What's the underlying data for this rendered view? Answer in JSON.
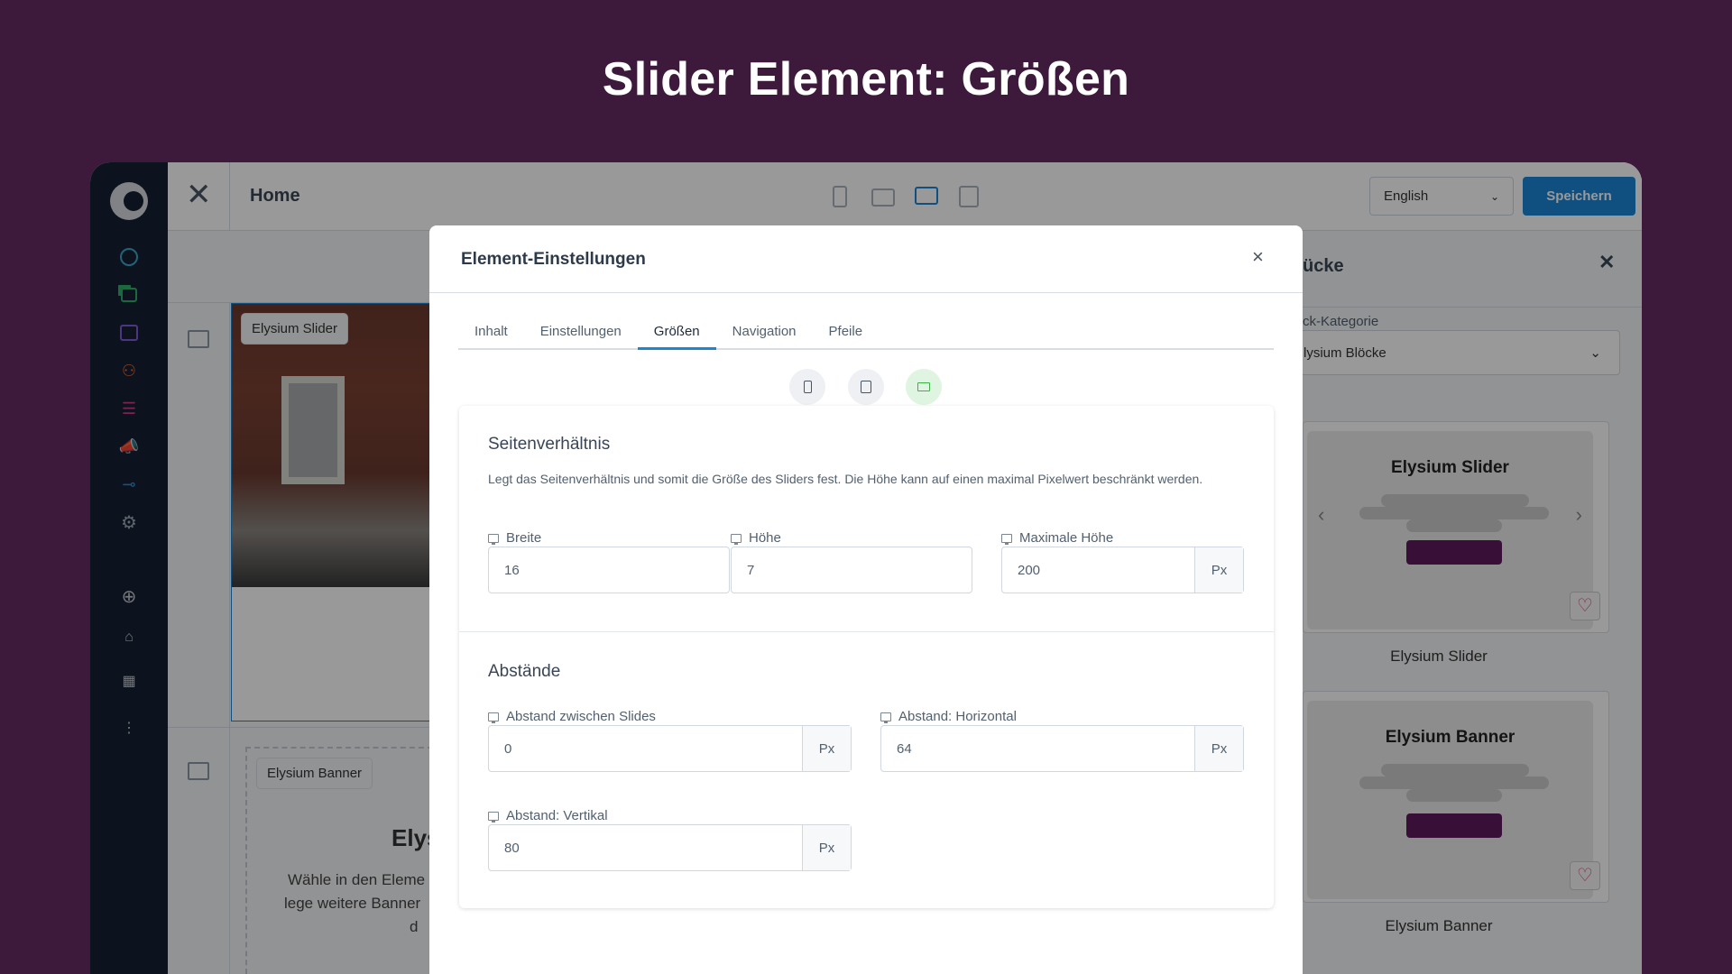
{
  "headline": "Slider Element: Größen",
  "topbar": {
    "page_title": "Home",
    "language": "English",
    "save_label": "Speichern"
  },
  "sidebar": {
    "items": [
      "logo-icon",
      "dashboard-icon",
      "catalog-icon",
      "orders-icon",
      "customers-icon",
      "content-icon",
      "marketing-icon",
      "extensions-icon",
      "settings-icon",
      "add-icon",
      "basket-icon",
      "store-icon",
      "more-icon"
    ]
  },
  "canvas": {
    "slider_tag": "Elysium Slider",
    "banner_tag": "Elysium Banner",
    "banner_heading": "Elys",
    "banner_text": [
      "Wähle in den Eleme",
      "lege weitere Banner",
      "d"
    ]
  },
  "right_panel": {
    "title": "ücke",
    "category_label": "ck-Kategorie",
    "category_value": "lysium Blöcke",
    "blocks": [
      {
        "preview_title": "Elysium Slider",
        "label": "Elysium Slider"
      },
      {
        "preview_title": "Elysium Banner",
        "label": "Elysium Banner"
      }
    ]
  },
  "modal": {
    "title": "Element-Einstellungen",
    "tabs": [
      "Inhalt",
      "Einstellungen",
      "Größen",
      "Navigation",
      "Pfeile"
    ],
    "active_tab": "Größen",
    "active_device": "desktop",
    "aspect": {
      "heading": "Seitenverhältnis",
      "description": "Legt das Seitenverhältnis und somit die Größe des Sliders fest. Die Höhe kann auf einen maximal Pixelwert beschränkt werden.",
      "width_label": "Breite",
      "width_value": "16",
      "height_label": "Höhe",
      "height_value": "7",
      "max_height_label": "Maximale Höhe",
      "max_height_value": "200",
      "unit": "Px"
    },
    "spacing": {
      "heading": "Abstände",
      "gap_label": "Abstand zwischen Slides",
      "gap_value": "0",
      "horizontal_label": "Abstand: Horizontal",
      "horizontal_value": "64",
      "vertical_label": "Abstand: Vertikal",
      "vertical_value": "80",
      "unit": "Px"
    }
  },
  "colors": {
    "background": "#3d1a3c",
    "accent": "#1b86d6",
    "brand_purple": "#5e1b5c",
    "active_device": "#3bb54a"
  }
}
